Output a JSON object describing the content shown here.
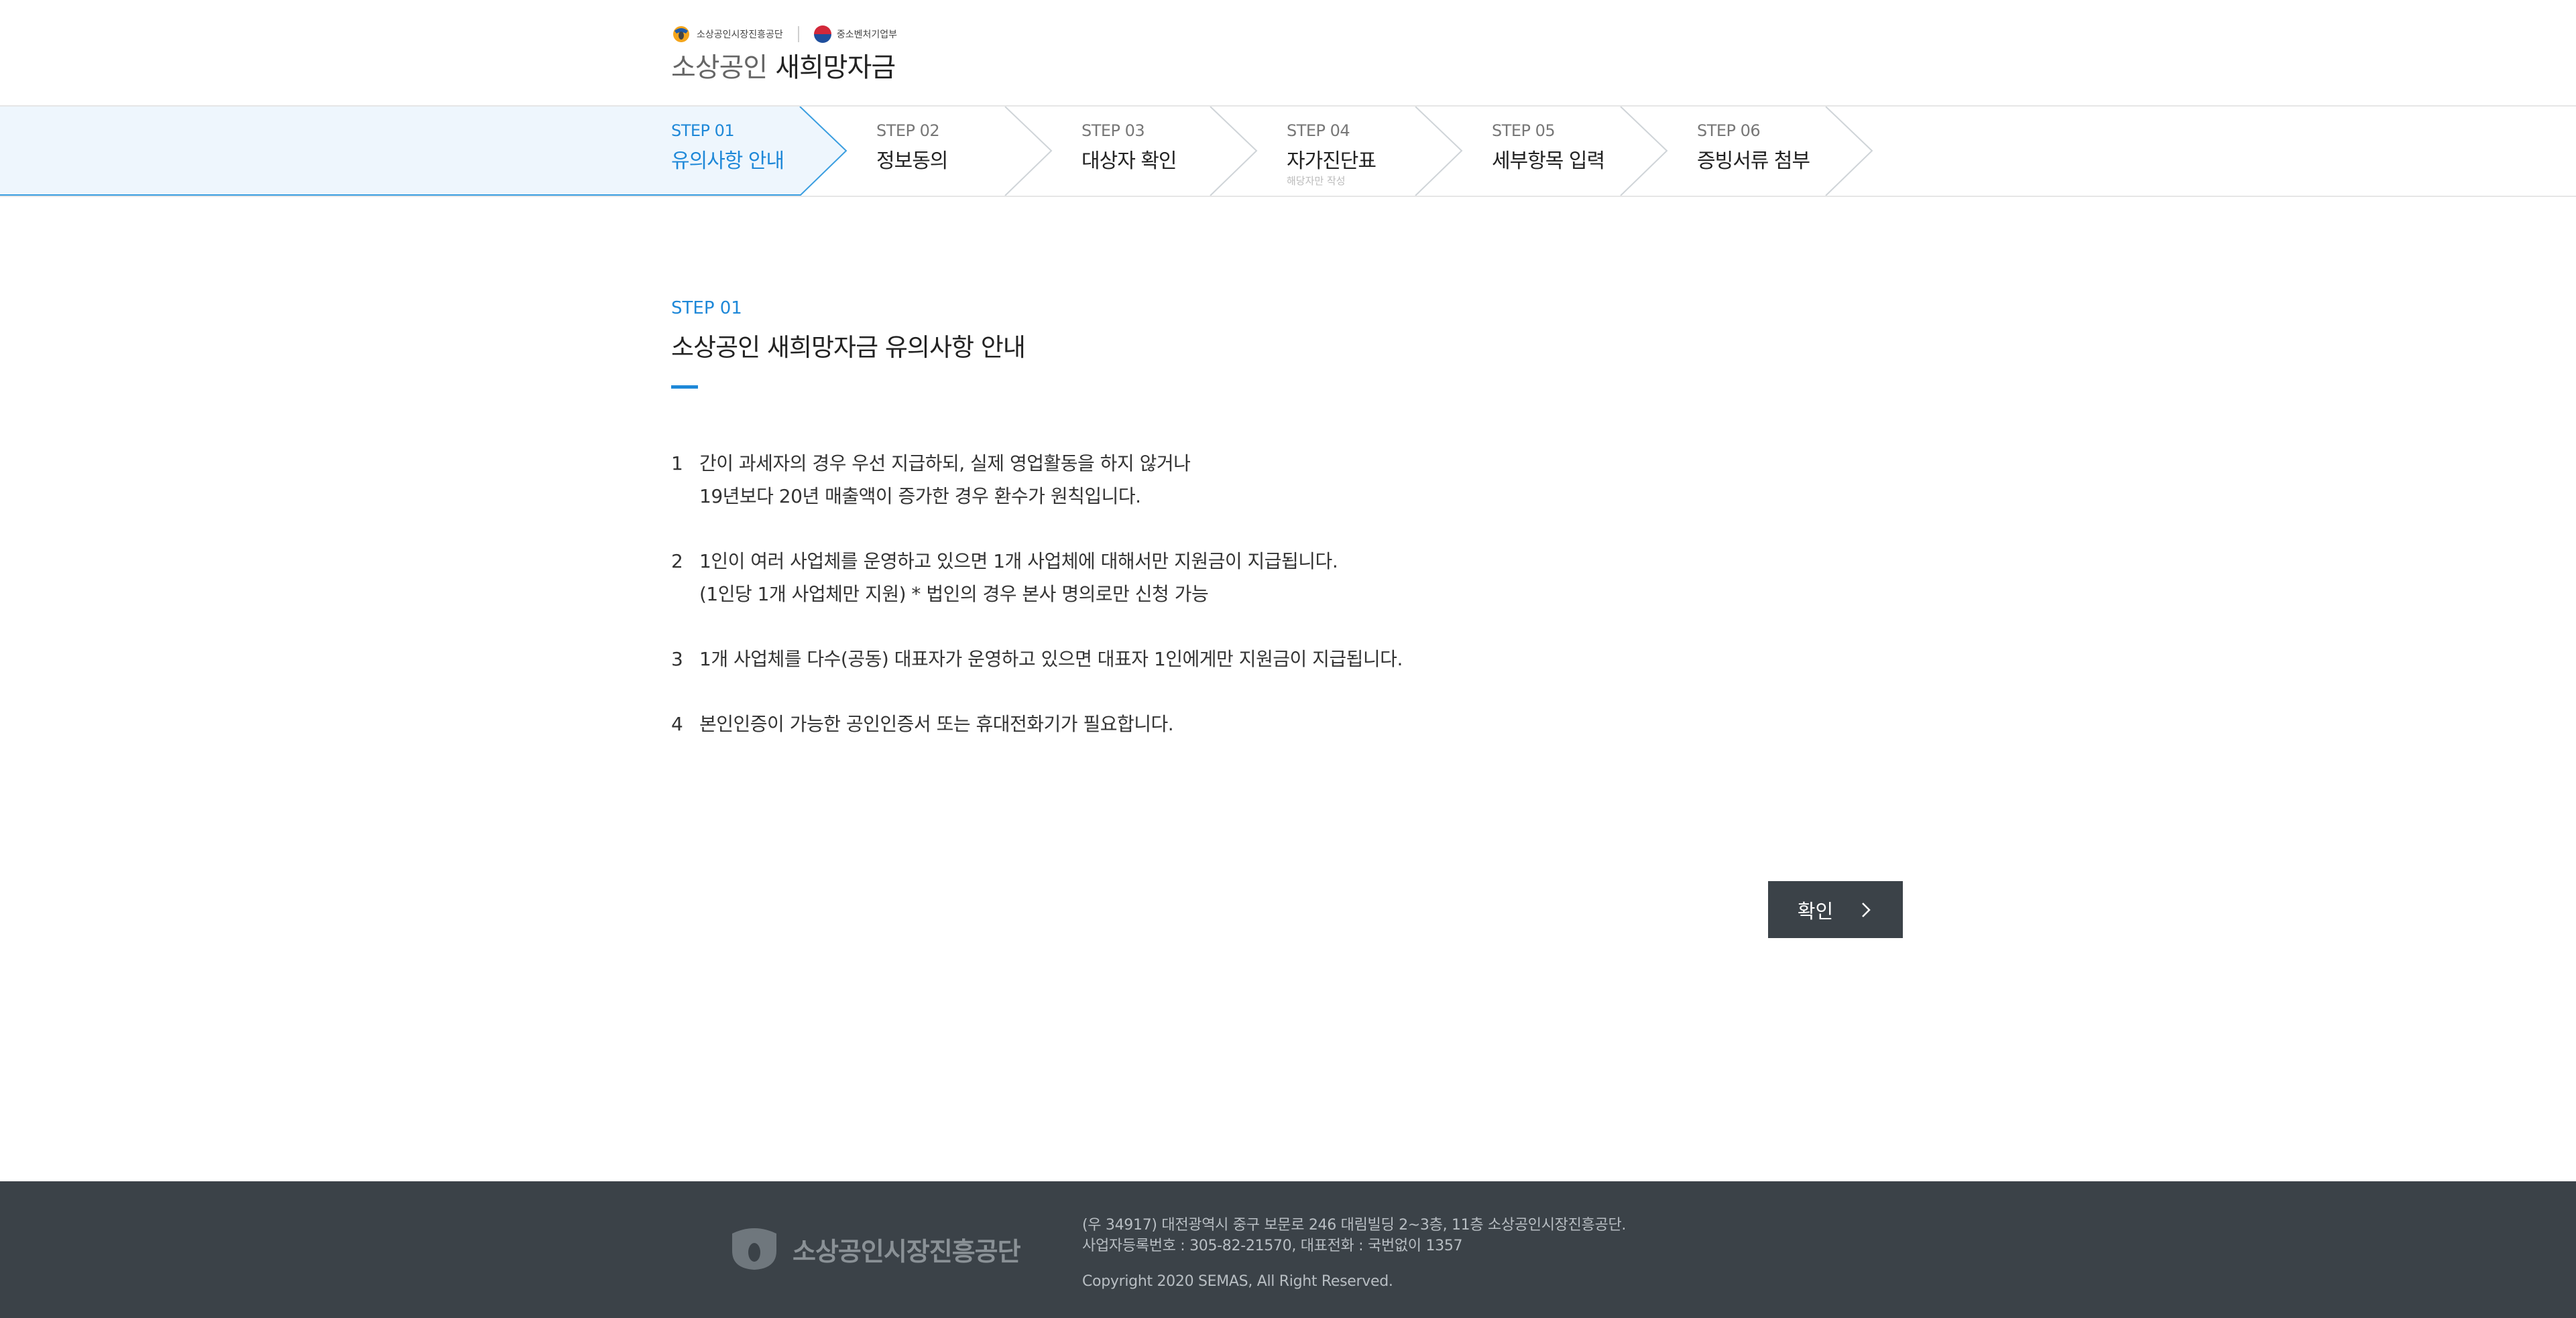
{
  "header": {
    "org1_name": "소상공인시장진흥공단",
    "org2_name": "중소벤처기업부",
    "title_light": "소상공인",
    "title_strong": "새희망자금"
  },
  "steps": [
    {
      "num": "STEP 01",
      "label": "유의사항 안내",
      "sub": ""
    },
    {
      "num": "STEP 02",
      "label": "정보동의",
      "sub": ""
    },
    {
      "num": "STEP 03",
      "label": "대상자 확인",
      "sub": ""
    },
    {
      "num": "STEP 04",
      "label": "자가진단표",
      "sub": "해당자만 작성"
    },
    {
      "num": "STEP 05",
      "label": "세부항목 입력",
      "sub": ""
    },
    {
      "num": "STEP 06",
      "label": "증빙서류 첨부",
      "sub": ""
    }
  ],
  "active_step": "STEP 01",
  "content": {
    "step_label": "STEP 01",
    "title": "소상공인 새희망자금 유의사항 안내",
    "notices": [
      {
        "num": "1",
        "lines": [
          "간이 과세자의 경우 우선 지급하되, 실제 영업활동을 하지 않거나",
          "19년보다 20년 매출액이 증가한 경우 환수가 원칙입니다."
        ]
      },
      {
        "num": "2",
        "lines": [
          "1인이 여러 사업체를 운영하고 있으면 1개 사업체에 대해서만 지원금이 지급됩니다.",
          "(1인당 1개 사업체만 지원) * 법인의 경우 본사 명의로만 신청 가능"
        ]
      },
      {
        "num": "3",
        "lines": [
          "1개 사업체를 다수(공동) 대표자가 운영하고 있으면 대표자 1인에게만 지원금이 지급됩니다."
        ]
      },
      {
        "num": "4",
        "lines": [
          "본인인증이 가능한 공인인증서 또는 휴대전화기가 필요합니다."
        ]
      }
    ],
    "confirm_label": "확인"
  },
  "footer": {
    "logo_text": "소상공인시장진흥공단",
    "address": "(우 34917) 대전광역시 중구 보문로 246 대림빌딩 2~3층, 11층 소상공인시장진흥공단.",
    "business_info": "사업자등록번호 : 305-82-21570, 대표전화 : 국번없이 1357",
    "copyright": "Copyright 2020 SEMAS, All Right Reserved."
  },
  "colors": {
    "accent": "#1e88d8",
    "active_step_bg": "#eef6fd",
    "footer_bg": "#3b4248",
    "button_bg": "#3b4248"
  },
  "icons": {
    "semas_logo": "semas-logo-icon",
    "mss_logo": "mss-emblem-icon",
    "confirm_chevron": "chevron-right-icon",
    "step_separator": "step-arrow-icon"
  }
}
